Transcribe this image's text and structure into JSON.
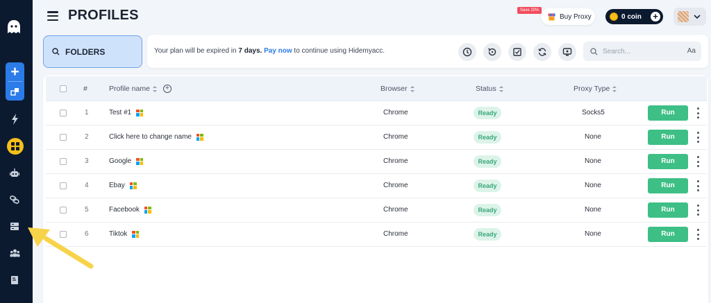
{
  "header": {
    "title": "PROFILES",
    "save_badge": "Save 20%",
    "buy_proxy_label": "Buy Proxy",
    "coin_label": "0 coin"
  },
  "folders": {
    "label": "FOLDERS"
  },
  "info_bar": {
    "text_before": "Your plan will be expired in ",
    "days": "7 days.",
    "pay_now": "Pay now",
    "text_after": " to continue using Hidemyacc."
  },
  "search": {
    "placeholder": "Search...",
    "case_toggle": "Aa"
  },
  "table": {
    "columns": {
      "index": "#",
      "profile_name": "Profile name",
      "browser": "Browser",
      "status": "Status",
      "proxy_type": "Proxy Type"
    },
    "rows": [
      {
        "index": "1",
        "name": "Test #1",
        "browser": "Chrome",
        "status": "Ready",
        "proxy": "Socks5",
        "action": "Run"
      },
      {
        "index": "2",
        "name": "Click here to change name",
        "browser": "Chrome",
        "status": "Ready",
        "proxy": "None",
        "action": "Run"
      },
      {
        "index": "3",
        "name": "Google",
        "browser": "Chrome",
        "status": "Ready",
        "proxy": "None",
        "action": "Run"
      },
      {
        "index": "4",
        "name": "Ebay",
        "browser": "Chrome",
        "status": "Ready",
        "proxy": "None",
        "action": "Run"
      },
      {
        "index": "5",
        "name": "Facebook",
        "browser": "Chrome",
        "status": "Ready",
        "proxy": "None",
        "action": "Run"
      },
      {
        "index": "6",
        "name": "Tiktok",
        "browser": "Chrome",
        "status": "Ready",
        "proxy": "None",
        "action": "Run"
      }
    ]
  },
  "sidebar": {
    "items": [
      "ghost-logo",
      "add-icon",
      "boxes-icon",
      "bolt-icon",
      "grid-icon",
      "robot-icon",
      "link-icon",
      "server-icon",
      "team-icon",
      "book-icon"
    ],
    "active_color": "#f6bf1a"
  },
  "colors": {
    "sidebar_bg": "#0c1a30",
    "accent": "#2b7ce8",
    "run": "#3dbf86",
    "ready_text": "#3aa77a",
    "annotation_arrow": "#f7d34a"
  }
}
